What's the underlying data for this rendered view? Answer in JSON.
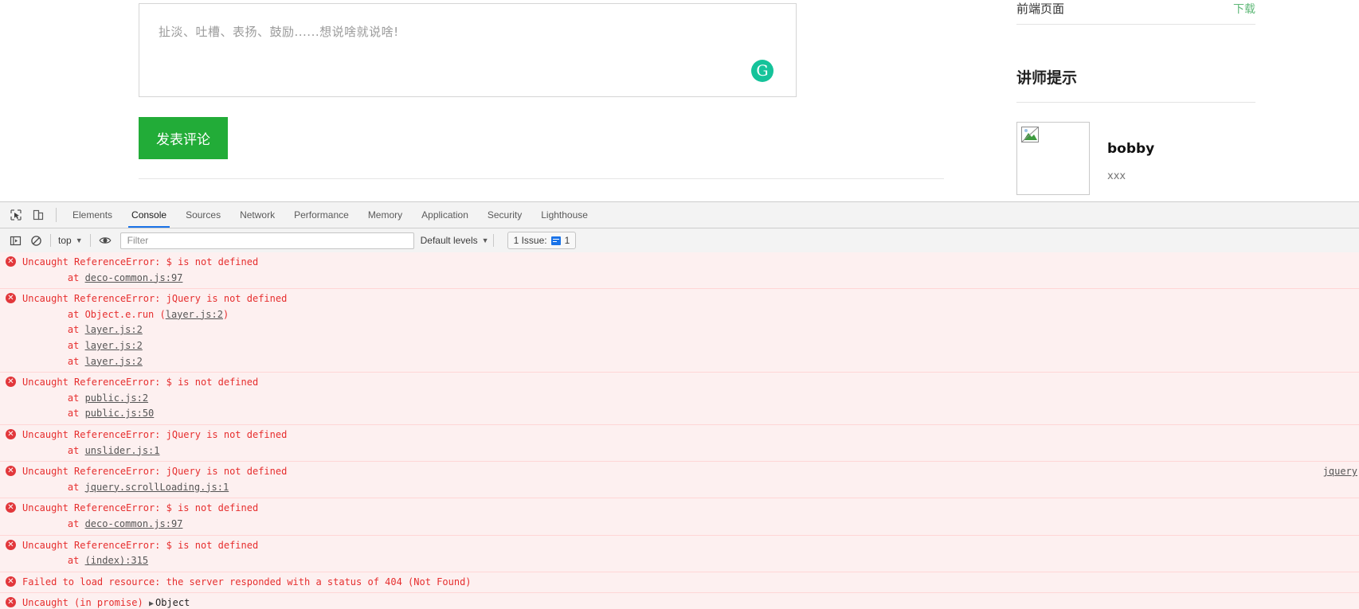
{
  "page": {
    "comment_box": {
      "placeholder": "扯淡、吐槽、表扬、鼓励......想说啥就说啥!",
      "value": "",
      "grammarly_glyph": "G"
    },
    "submit_label": "发表评论"
  },
  "sidebar": {
    "attachment_name": "前端页面",
    "download_label": "下载",
    "section_heading": "讲师提示",
    "teacher": {
      "name": "bobby",
      "description": "xxx"
    }
  },
  "devtools": {
    "tabs": [
      {
        "label": "Elements",
        "active": false
      },
      {
        "label": "Console",
        "active": true
      },
      {
        "label": "Sources",
        "active": false
      },
      {
        "label": "Network",
        "active": false
      },
      {
        "label": "Performance",
        "active": false
      },
      {
        "label": "Memory",
        "active": false
      },
      {
        "label": "Application",
        "active": false
      },
      {
        "label": "Security",
        "active": false
      },
      {
        "label": "Lighthouse",
        "active": false
      }
    ],
    "toolbar": {
      "context_label": "top",
      "filter_placeholder": "Filter",
      "filter_value": "",
      "levels_label": "Default levels",
      "issues_label": "1 Issue:",
      "issues_count": "1",
      "caret": "▼"
    },
    "messages": [
      {
        "icon": "error-icon",
        "title": "Uncaught ReferenceError: $ is not defined",
        "stack": [
          {
            "prefix": "    at ",
            "link": "deco-common.js:97",
            "suffix": ""
          }
        ],
        "source": ""
      },
      {
        "icon": "error-icon",
        "title": "Uncaught ReferenceError: jQuery is not defined",
        "stack": [
          {
            "prefix": "    at Object.e.run (",
            "link": "layer.js:2",
            "suffix": ")"
          },
          {
            "prefix": "    at ",
            "link": "layer.js:2",
            "suffix": ""
          },
          {
            "prefix": "    at ",
            "link": "layer.js:2",
            "suffix": ""
          },
          {
            "prefix": "    at ",
            "link": "layer.js:2",
            "suffix": ""
          }
        ],
        "source": ""
      },
      {
        "icon": "error-icon",
        "title": "Uncaught ReferenceError: $ is not defined",
        "stack": [
          {
            "prefix": "    at ",
            "link": "public.js:2",
            "suffix": ""
          },
          {
            "prefix": "    at ",
            "link": "public.js:50",
            "suffix": ""
          }
        ],
        "source": ""
      },
      {
        "icon": "error-icon",
        "title": "Uncaught ReferenceError: jQuery is not defined",
        "stack": [
          {
            "prefix": "    at ",
            "link": "unslider.js:1",
            "suffix": ""
          }
        ],
        "source": ""
      },
      {
        "icon": "error-icon",
        "title": "Uncaught ReferenceError: jQuery is not defined",
        "stack": [
          {
            "prefix": "    at ",
            "link": "jquery.scrollLoading.js:1",
            "suffix": ""
          }
        ],
        "source": "jquery"
      },
      {
        "icon": "error-icon",
        "title": "Uncaught ReferenceError: $ is not defined",
        "stack": [
          {
            "prefix": "    at ",
            "link": "deco-common.js:97",
            "suffix": ""
          }
        ],
        "source": ""
      },
      {
        "icon": "error-icon",
        "title": "Uncaught ReferenceError: $ is not defined",
        "stack": [
          {
            "prefix": "    at ",
            "link": "(index):315",
            "suffix": ""
          }
        ],
        "source": ""
      },
      {
        "icon": "error-icon",
        "title": "Failed to load resource: the server responded with a status of 404 (Not Found)",
        "stack": [],
        "source": ""
      },
      {
        "icon": "error-icon",
        "title": "Uncaught (in promise) ",
        "object_label": "Object",
        "disclosure": "▶",
        "stack": [],
        "source": ""
      }
    ]
  },
  "colors": {
    "error_text": "#e62e2e",
    "error_bg": "#fdf0f0",
    "accent_blue": "#1a73e8",
    "brand_green": "#22ac38",
    "link_green": "#5fb878",
    "grammarly_green": "#15c39a"
  }
}
